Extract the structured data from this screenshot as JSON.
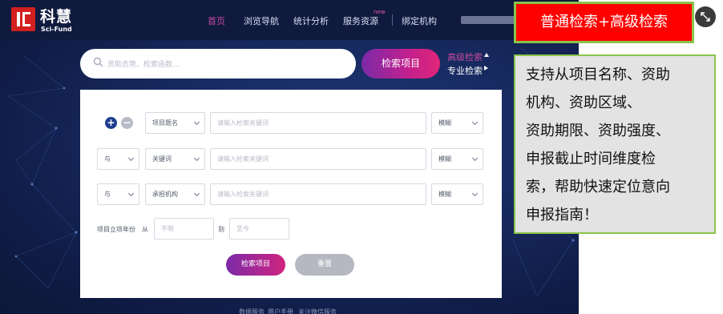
{
  "app": {
    "logo_cn": "科慧",
    "logo_en": "Sci-Fund"
  },
  "nav": {
    "items": [
      {
        "label": "首页",
        "active": true
      },
      {
        "label": "浏览导航"
      },
      {
        "label": "统计分析"
      },
      {
        "label": "服务资源"
      },
      {
        "label": "绑定机构"
      }
    ],
    "new_badge": "new"
  },
  "search": {
    "placeholder": "资助态势、检索函数...",
    "button": "检索项目",
    "advanced_link": "高级检索",
    "professional_link": "专业检索"
  },
  "advanced": {
    "rows": [
      {
        "field": "项目题名",
        "placeholder": "请输入检索关键词",
        "match": "模糊"
      },
      {
        "logic": "与",
        "field": "关键词",
        "placeholder": "请输入检索关键词",
        "match": "模糊"
      },
      {
        "logic": "与",
        "field": "承担机构",
        "placeholder": "请输入检索关键词",
        "match": "模糊"
      }
    ],
    "year": {
      "label": "项目立项年份",
      "from_label": "从",
      "from_placeholder": "不限",
      "to_label": "到",
      "to_placeholder": "至今"
    },
    "search_button": "检索项目",
    "reset_button": "重置"
  },
  "footer": {
    "links": [
      "数据服务",
      "用户手册",
      "关注微信服务"
    ]
  },
  "annotation": {
    "title": "普通检索+高级检索",
    "description_lines": [
      "支持从项目名称、资助",
      "机构、资助区域、",
      "资助期限、资助强度、",
      "申报截止时间维度检",
      "索，帮助快速定位意向",
      "申报指南！"
    ]
  },
  "colors": {
    "brand_red": "#d22020",
    "accent_magenta": "#c3208c",
    "background_navy": "#172a60",
    "callout_red": "#ff0000",
    "callout_border_green": "#8bc34a"
  }
}
